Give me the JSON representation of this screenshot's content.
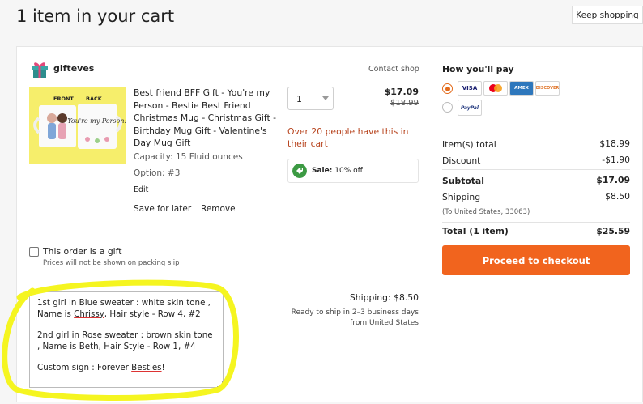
{
  "header": {
    "title": "1 item in your cart",
    "keep_shopping": "Keep shopping"
  },
  "shop": {
    "name": "gifteves",
    "contact": "Contact shop"
  },
  "item": {
    "title": "Best friend BFF Gift - You're my Person - Bestie Best Friend Christmas Mug - Christmas Gift - Birthday Mug Gift - Valentine's Day Mug Gift",
    "image_text": {
      "front": "FRONT",
      "back": "BACK",
      "mug_text": "You're my Person!"
    },
    "capacity": "Capacity: 15 Fluid ounces",
    "option": "Option: #3",
    "edit": "Edit",
    "save_for_later": "Save for later",
    "remove": "Remove",
    "quantity": "1",
    "price": "$17.09",
    "original_price": "$18.99",
    "demand": "Over 20 people have this in their cart",
    "sale_label": "Sale:",
    "sale_value": "10% off"
  },
  "gift": {
    "label": "This order is a gift",
    "sublabel": "Prices will not be shown on packing slip"
  },
  "note": {
    "line1_a": "1st girl in Blue sweater : white skin tone , Name is ",
    "line1_name": "Chrissy",
    "line1_b": ", Hair style - Row 4, #2",
    "line2": "2nd girl in Rose sweater : brown skin tone , Name is Beth, Hair Style - Row 1, #4",
    "line3_a": "Custom sign : Forever ",
    "line3_word": "Besties",
    "line3_b": "!"
  },
  "shipping": {
    "cost": "Shipping: $8.50",
    "eta_line1": "Ready to ship in 2–3 business days",
    "eta_line2": "from United States"
  },
  "payment": {
    "title": "How you'll pay",
    "cards": [
      "VISA",
      "mastercard-icon",
      "AMEX",
      "DISCOVER"
    ],
    "paypal": "PayPal"
  },
  "summary": {
    "items_total_label": "Item(s) total",
    "items_total": "$18.99",
    "discount_label": "Discount",
    "discount": "-$1.90",
    "subtotal_label": "Subtotal",
    "subtotal": "$17.09",
    "shipping_label": "Shipping",
    "shipping": "$8.50",
    "shipping_dest": "(To United States, 33063)",
    "total_label": "Total (1 item)",
    "total": "$25.59",
    "checkout": "Proceed to checkout"
  },
  "colors": {
    "accent": "#f1641e",
    "sale_green": "#3c9a43",
    "demand": "#b7431d",
    "highlight": "#f5f520"
  }
}
